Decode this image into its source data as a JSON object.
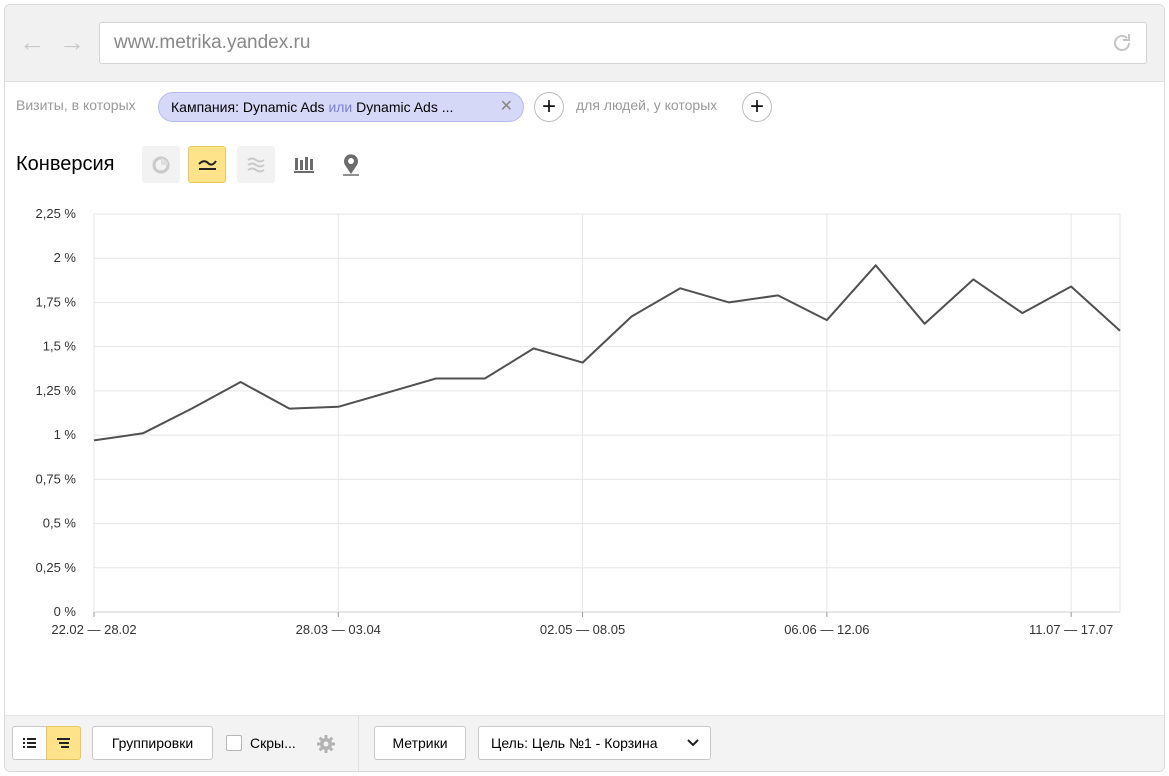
{
  "browser": {
    "url": "www.metrika.yandex.ru"
  },
  "filters": {
    "visits_label": "Визиты, в которых",
    "chip": {
      "part1": "Кампания: Dynamic Ads ",
      "or": "или",
      "part2": " Dynamic Ads ..."
    },
    "people_label": "для людей, у которых"
  },
  "chart_header": {
    "title": "Конверсия"
  },
  "chart_data": {
    "type": "line",
    "y_ticks": [
      "0 %",
      "0,25 %",
      "0,5 %",
      "0,75 %",
      "1 %",
      "1,25 %",
      "1,5 %",
      "1,75 %",
      "2 %",
      "2,25 %"
    ],
    "x_tick_labels": [
      {
        "index": 0,
        "label": "22.02 — 28.02"
      },
      {
        "index": 5,
        "label": "28.03 — 03.04"
      },
      {
        "index": 10,
        "label": "02.05 — 08.05"
      },
      {
        "index": 15,
        "label": "06.06 — 12.06"
      },
      {
        "index": 20,
        "label": "11.07 — 17.07"
      }
    ],
    "ylim": [
      0,
      2.25
    ],
    "series": [
      {
        "values": [
          0.97,
          1.01,
          1.15,
          1.3,
          1.15,
          1.16,
          1.24,
          1.32,
          1.32,
          1.49,
          1.41,
          1.67,
          1.83,
          1.75,
          1.79,
          1.65,
          1.96,
          1.63,
          1.88,
          1.69,
          1.84,
          1.59
        ],
        "color": "#505050"
      }
    ],
    "grid": true
  },
  "bottom": {
    "groupings_label": "Группировки",
    "hide_label": "Скры...",
    "metrics_label": "Метрики",
    "goal_label": "Цель: Цель №1 - Корзина"
  },
  "colors": {
    "active_button": "#ffe38a",
    "chip_bg": "#d6d8f8",
    "line": "#505050"
  }
}
